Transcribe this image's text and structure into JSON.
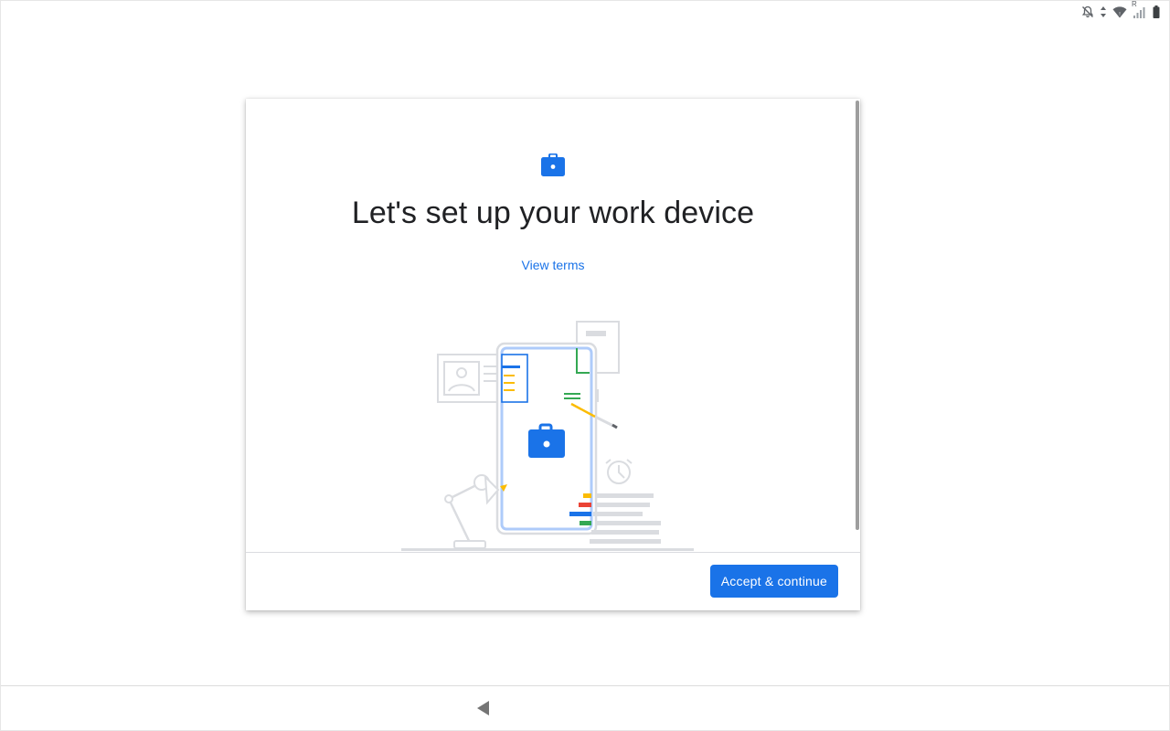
{
  "status_bar": {
    "icons": [
      "notifications-off-icon",
      "data-activity-icon",
      "wifi-icon",
      "signal-roaming-icon",
      "battery-icon"
    ],
    "roaming_label": "R"
  },
  "dialog": {
    "header_icon": "briefcase-icon",
    "title": "Let's set up your work device",
    "view_terms_label": "View terms",
    "illustration": "work-device-illustration",
    "accept_label": "Accept & continue"
  },
  "nav_bar": {
    "back_icon": "back-triangle-icon"
  },
  "colors": {
    "accent": "#1a73e8",
    "title": "#202124",
    "divider": "#dadce0",
    "illustration_gray": "#dadce0",
    "illustration_blue": "#aecbfa",
    "green": "#34a853",
    "yellow": "#fbbc04",
    "red": "#ea4335"
  }
}
